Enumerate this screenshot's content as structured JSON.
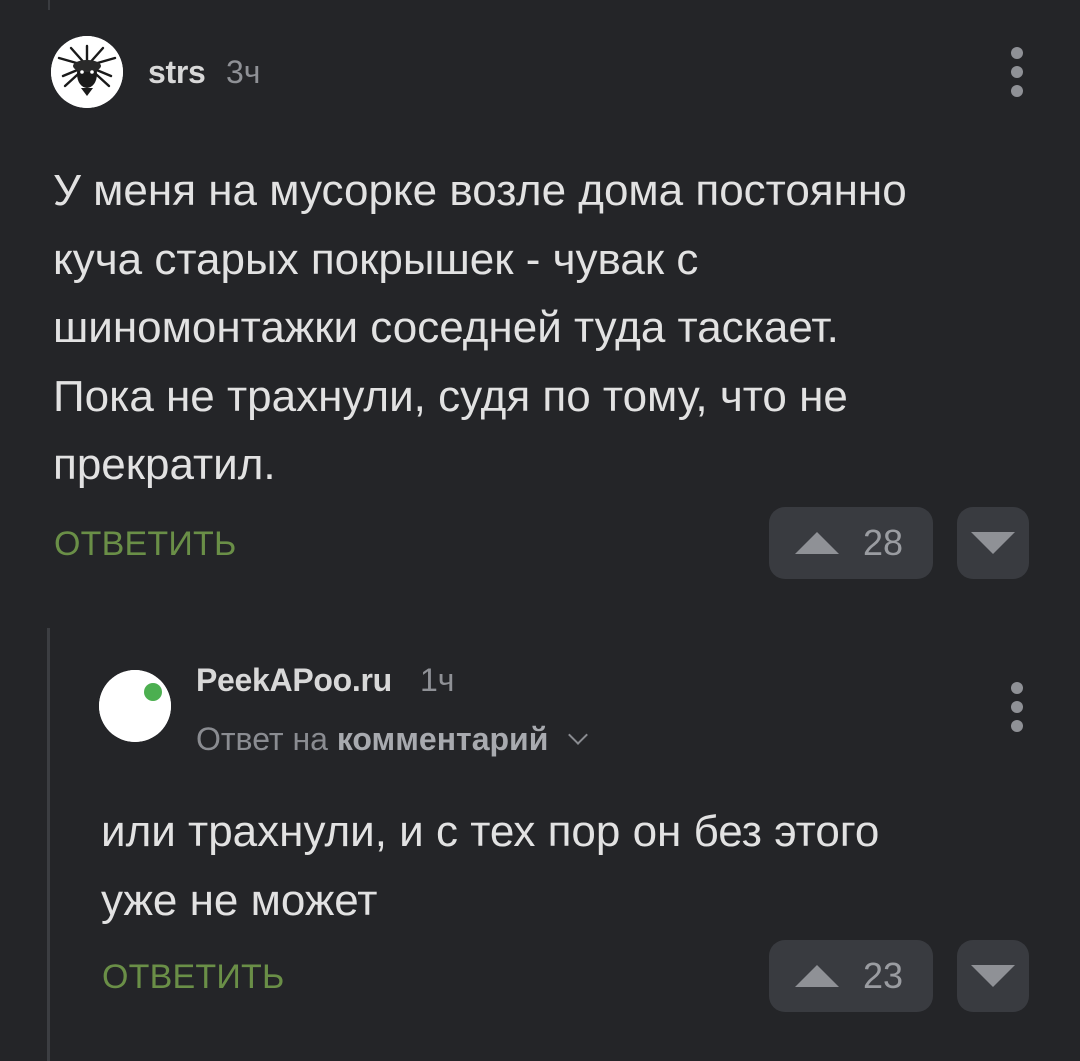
{
  "comments": [
    {
      "author": "strs",
      "time": "3ч",
      "text": "У меня на мусорке возле дома постоянно\nкуча старых покрышек - чувак с\nшиномонтажки соседней туда таскает.\nПока не трахнули, судя по тому, что не\nпрекратил.",
      "reply_label": "ОТВЕТИТЬ",
      "votes": "28"
    },
    {
      "author": "PeekAPoo.ru",
      "time": "1ч",
      "reply_to_prefix": "Ответ на",
      "reply_to_target": "комментарий",
      "text": "или трахнули, и с тех пор он без этого\nуже не может",
      "reply_label": "ОТВЕТИТЬ",
      "votes": "23",
      "online_color": "#4caf50"
    }
  ],
  "colors": {
    "background": "#242528",
    "reply_green": "#6a8f47",
    "button_bg": "#393b40"
  },
  "icons": {
    "more": "more-vertical-icon",
    "upvote": "triangle-up-icon",
    "downvote": "triangle-down-icon",
    "chevron": "chevron-down-icon"
  }
}
